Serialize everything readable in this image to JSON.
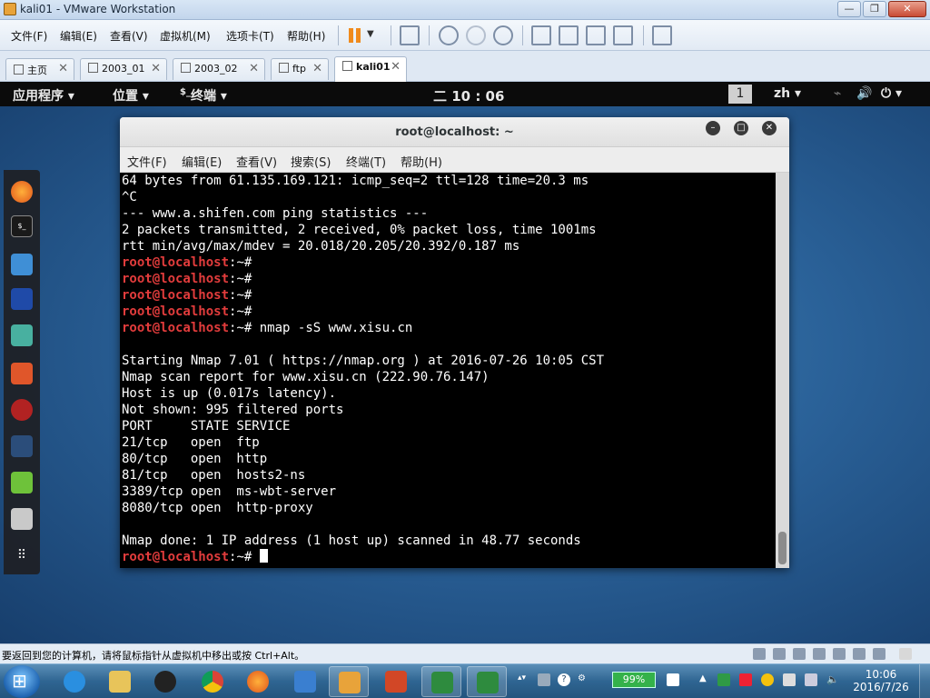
{
  "vm_window": {
    "title": "kali01 - VMware Workstation",
    "controls": {
      "minimize": "—",
      "maximize": "❐",
      "close": "✕"
    }
  },
  "vm_menu": [
    "文件(F)",
    "编辑(E)",
    "查看(V)",
    "虚拟机(M)",
    "选项卡(T)",
    "帮助(H)"
  ],
  "vm_tabs": [
    {
      "label": "主页",
      "active": false
    },
    {
      "label": "2003_01",
      "active": false
    },
    {
      "label": "2003_02",
      "active": false
    },
    {
      "label": "ftp",
      "active": false
    },
    {
      "label": "kali01",
      "active": true
    }
  ],
  "kali_panel": {
    "apps": "应用程序",
    "places": "位置",
    "terminal": "终端",
    "terminal_glyph": "$_",
    "clock": "二 10 : 06",
    "workspace": "1",
    "lang": "zh"
  },
  "terminal": {
    "title": "root@localhost: ~",
    "menu": [
      "文件(F)",
      "编辑(E)",
      "查看(V)",
      "搜索(S)",
      "终端(T)",
      "帮助(H)"
    ],
    "prompt_user": "root@localhost",
    "prompt_suffix": ":~#",
    "lines": [
      {
        "type": "text",
        "text": "64 bytes from 61.135.169.121: icmp_seq=2 ttl=128 time=20.3 ms"
      },
      {
        "type": "text",
        "text": "^C"
      },
      {
        "type": "text",
        "text": "--- www.a.shifen.com ping statistics ---"
      },
      {
        "type": "text",
        "text": "2 packets transmitted, 2 received, 0% packet loss, time 1001ms"
      },
      {
        "type": "text",
        "text": "rtt min/avg/max/mdev = 20.018/20.205/20.392/0.187 ms"
      },
      {
        "type": "prompt",
        "text": ""
      },
      {
        "type": "prompt",
        "text": ""
      },
      {
        "type": "prompt",
        "text": ""
      },
      {
        "type": "prompt",
        "text": ""
      },
      {
        "type": "prompt",
        "text": " nmap -sS www.xisu.cn"
      },
      {
        "type": "text",
        "text": ""
      },
      {
        "type": "text",
        "text": "Starting Nmap 7.01 ( https://nmap.org ) at 2016-07-26 10:05 CST"
      },
      {
        "type": "text",
        "text": "Nmap scan report for www.xisu.cn (222.90.76.147)"
      },
      {
        "type": "text",
        "text": "Host is up (0.017s latency)."
      },
      {
        "type": "text",
        "text": "Not shown: 995 filtered ports"
      },
      {
        "type": "text",
        "text": "PORT     STATE SERVICE"
      },
      {
        "type": "text",
        "text": "21/tcp   open  ftp"
      },
      {
        "type": "text",
        "text": "80/tcp   open  http"
      },
      {
        "type": "text",
        "text": "81/tcp   open  hosts2-ns"
      },
      {
        "type": "text",
        "text": "3389/tcp open  ms-wbt-server"
      },
      {
        "type": "text",
        "text": "8080/tcp open  http-proxy"
      },
      {
        "type": "text",
        "text": ""
      },
      {
        "type": "text",
        "text": "Nmap done: 1 IP address (1 host up) scanned in 48.77 seconds"
      },
      {
        "type": "prompt-cursor",
        "text": " "
      }
    ]
  },
  "statusbar": {
    "message": "要返回到您的计算机，请将鼠标指针从虚拟机中移出或按 Ctrl+Alt。"
  },
  "taskbar": {
    "battery": "99%",
    "time": "10:06",
    "date": "2016/7/26"
  },
  "colors": {
    "prompt_user": "#e23c3c",
    "prompt_path": "#4a7fd8",
    "terminal_bg": "#000000",
    "pause_icon": "#f08a1c",
    "battery": "#34b24a"
  }
}
